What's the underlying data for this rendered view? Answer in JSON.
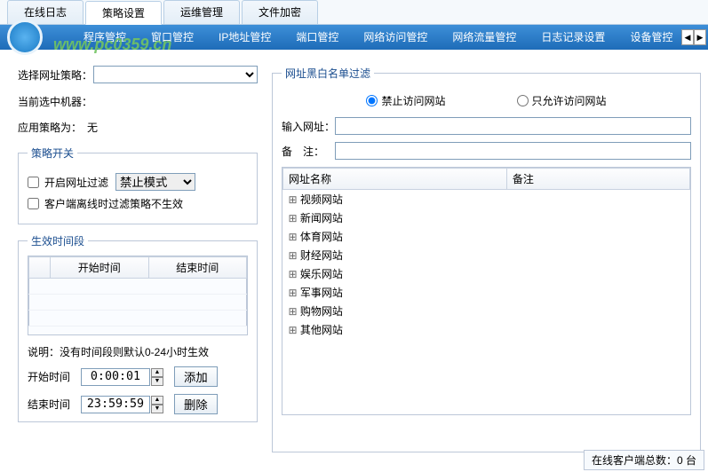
{
  "tabs": [
    "在线日志",
    "策略设置",
    "运维管理",
    "文件加密"
  ],
  "activeTab": 1,
  "nav": [
    "程序管控",
    "窗口管控",
    "IP地址管控",
    "端口管控",
    "网络访问管控",
    "网络流量管控",
    "日志记录设置",
    "设备管控"
  ],
  "watermark": "www.pc0359.cn",
  "left": {
    "selectPolicyLabel": "选择网址策略：",
    "currentMachineLabel": "当前选中机器：",
    "applyPolicyLabel": "应用策略为：",
    "applyPolicyValue": "无",
    "switchLegend": "策略开关",
    "enableFilterLabel": "开启网址过滤",
    "modeValue": "禁止模式",
    "offlineLabel": "客户端离线时过滤策略不生效",
    "periodLegend": "生效时间段",
    "startHeader": "开始时间",
    "endHeader": "结束时间",
    "note": "说明：没有时间段则默认0-24小时生效",
    "startLabel": "开始时间",
    "endLabel": "结束时间",
    "startValue": "0:00:01",
    "endValue": "23:59:59",
    "addBtn": "添加",
    "delBtn": "删除"
  },
  "right": {
    "legend": "网址黑白名单过滤",
    "radioDeny": "禁止访问网站",
    "radioAllow": "只允许访问网站",
    "inputUrlLabel": "输入网址：",
    "remarkLabel": "备　注：",
    "colName": "网址名称",
    "colRemark": "备注",
    "categories": [
      "视频网站",
      "新闻网站",
      "体育网站",
      "财经网站",
      "娱乐网站",
      "军事网站",
      "购物网站",
      "其他网站"
    ]
  },
  "status": {
    "label": "在线客户端总数：",
    "value": "0 台"
  }
}
